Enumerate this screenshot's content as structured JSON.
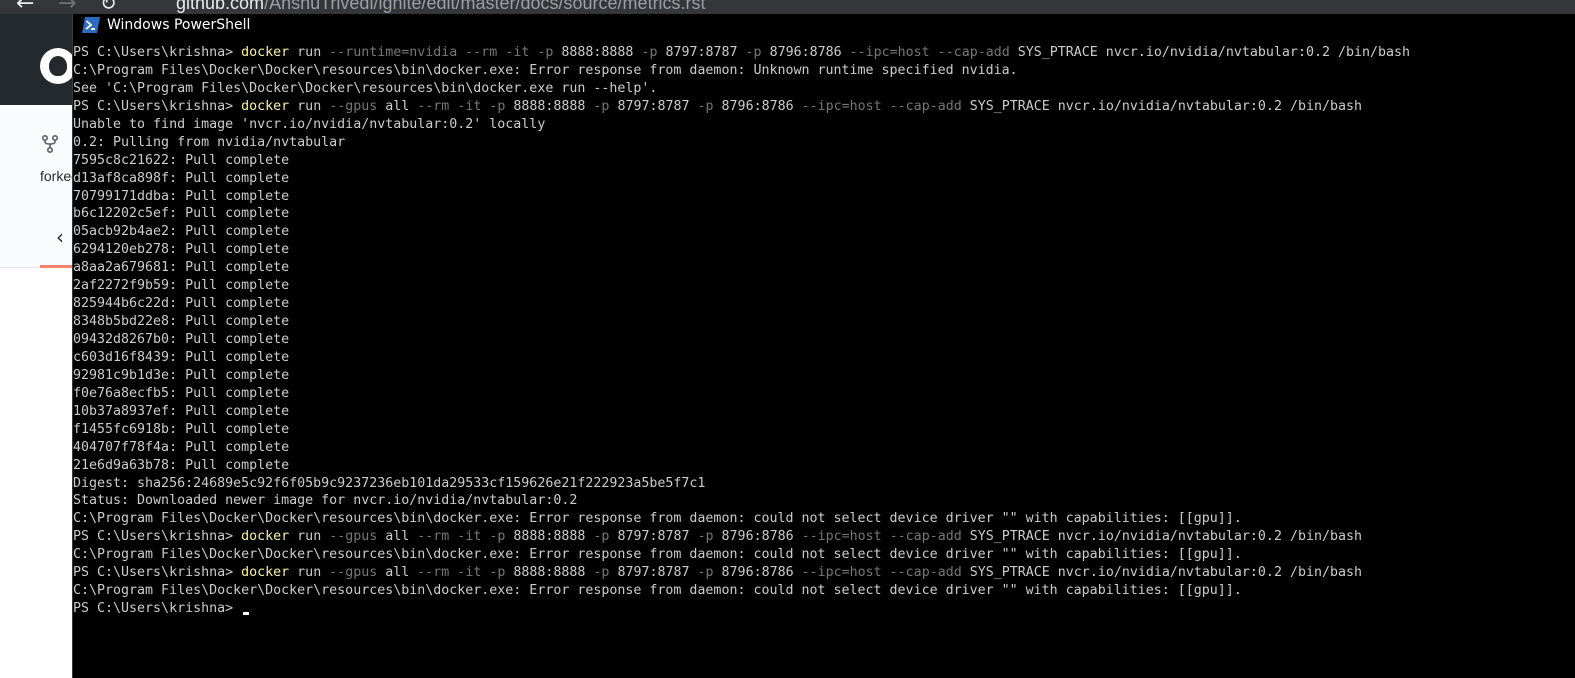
{
  "browser": {
    "back_glyph": "←",
    "forward_glyph": "→",
    "url_host": "github.com",
    "url_path": "/AnshuTrivedi/ignite/edit/master/docs/source/metrics.rst",
    "fork_label": "forked",
    "back_chevron": "‹"
  },
  "window": {
    "title": "Windows PowerShell",
    "icon": "powershell-icon"
  },
  "console": {
    "colors": {
      "background": "#000000",
      "text": "#cccccc",
      "command": "#f9f1a5",
      "parameter": "#767676"
    },
    "lines": [
      {
        "segments": [
          {
            "t": "PS C:\\Users\\krishna> ",
            "k": "arg"
          },
          {
            "t": "docker",
            "k": "cmd"
          },
          {
            "t": " run ",
            "k": "arg"
          },
          {
            "t": "--runtime=nvidia --rm -it -p ",
            "k": "param"
          },
          {
            "t": "8888:8888 ",
            "k": "arg"
          },
          {
            "t": "-p ",
            "k": "param"
          },
          {
            "t": "8797:8787 ",
            "k": "arg"
          },
          {
            "t": "-p ",
            "k": "param"
          },
          {
            "t": "8796:8786 ",
            "k": "arg"
          },
          {
            "t": "--ipc=host --cap-add ",
            "k": "param"
          },
          {
            "t": "SYS_PTRACE nvcr.io/nvidia/nvtabular:0.2 /bin/bash",
            "k": "arg"
          }
        ]
      },
      {
        "segments": [
          {
            "t": "C:\\Program Files\\Docker\\Docker\\resources\\bin\\docker.exe: Error response from daemon: Unknown runtime specified nvidia.",
            "k": "arg"
          }
        ]
      },
      {
        "segments": [
          {
            "t": "See 'C:\\Program Files\\Docker\\Docker\\resources\\bin\\docker.exe run --help'.",
            "k": "arg"
          }
        ]
      },
      {
        "segments": [
          {
            "t": "PS C:\\Users\\krishna> ",
            "k": "arg"
          },
          {
            "t": "docker",
            "k": "cmd"
          },
          {
            "t": " run ",
            "k": "arg"
          },
          {
            "t": "--gpus ",
            "k": "param"
          },
          {
            "t": "all ",
            "k": "arg"
          },
          {
            "t": "--rm -it -p ",
            "k": "param"
          },
          {
            "t": "8888:8888 ",
            "k": "arg"
          },
          {
            "t": "-p ",
            "k": "param"
          },
          {
            "t": "8797:8787 ",
            "k": "arg"
          },
          {
            "t": "-p ",
            "k": "param"
          },
          {
            "t": "8796:8786 ",
            "k": "arg"
          },
          {
            "t": "--ipc=host --cap-add ",
            "k": "param"
          },
          {
            "t": "SYS_PTRACE nvcr.io/nvidia/nvtabular:0.2 /bin/bash",
            "k": "arg"
          }
        ]
      },
      {
        "segments": [
          {
            "t": "Unable to find image 'nvcr.io/nvidia/nvtabular:0.2' locally",
            "k": "arg"
          }
        ]
      },
      {
        "segments": [
          {
            "t": "0.2: Pulling from nvidia/nvtabular",
            "k": "arg"
          }
        ]
      },
      {
        "segments": [
          {
            "t": "7595c8c21622: Pull complete",
            "k": "arg"
          }
        ]
      },
      {
        "segments": [
          {
            "t": "d13af8ca898f: Pull complete",
            "k": "arg"
          }
        ]
      },
      {
        "segments": [
          {
            "t": "70799171ddba: Pull complete",
            "k": "arg"
          }
        ]
      },
      {
        "segments": [
          {
            "t": "b6c12202c5ef: Pull complete",
            "k": "arg"
          }
        ]
      },
      {
        "segments": [
          {
            "t": "05acb92b4ae2: Pull complete",
            "k": "arg"
          }
        ]
      },
      {
        "segments": [
          {
            "t": "6294120eb278: Pull complete",
            "k": "arg"
          }
        ]
      },
      {
        "segments": [
          {
            "t": "a8aa2a679681: Pull complete",
            "k": "arg"
          }
        ]
      },
      {
        "segments": [
          {
            "t": "2af2272f9b59: Pull complete",
            "k": "arg"
          }
        ]
      },
      {
        "segments": [
          {
            "t": "825944b6c22d: Pull complete",
            "k": "arg"
          }
        ]
      },
      {
        "segments": [
          {
            "t": "8348b5bd22e8: Pull complete",
            "k": "arg"
          }
        ]
      },
      {
        "segments": [
          {
            "t": "09432d8267b0: Pull complete",
            "k": "arg"
          }
        ]
      },
      {
        "segments": [
          {
            "t": "c603d16f8439: Pull complete",
            "k": "arg"
          }
        ]
      },
      {
        "segments": [
          {
            "t": "92981c9b1d3e: Pull complete",
            "k": "arg"
          }
        ]
      },
      {
        "segments": [
          {
            "t": "f0e76a8ecfb5: Pull complete",
            "k": "arg"
          }
        ]
      },
      {
        "segments": [
          {
            "t": "10b37a8937ef: Pull complete",
            "k": "arg"
          }
        ]
      },
      {
        "segments": [
          {
            "t": "f1455fc6918b: Pull complete",
            "k": "arg"
          }
        ]
      },
      {
        "segments": [
          {
            "t": "404707f78f4a: Pull complete",
            "k": "arg"
          }
        ]
      },
      {
        "segments": [
          {
            "t": "21e6d9a63b78: Pull complete",
            "k": "arg"
          }
        ]
      },
      {
        "segments": [
          {
            "t": "Digest: sha256:24689e5c92f6f05b9c9237236eb101da29533cf159626e21f222923a5be5f7c1",
            "k": "arg"
          }
        ]
      },
      {
        "segments": [
          {
            "t": "Status: Downloaded newer image for nvcr.io/nvidia/nvtabular:0.2",
            "k": "arg"
          }
        ]
      },
      {
        "segments": [
          {
            "t": "C:\\Program Files\\Docker\\Docker\\resources\\bin\\docker.exe: Error response from daemon: could not select device driver \"\" with capabilities: [[gpu]].",
            "k": "arg"
          }
        ]
      },
      {
        "segments": [
          {
            "t": "PS C:\\Users\\krishna> ",
            "k": "arg"
          },
          {
            "t": "docker",
            "k": "cmd"
          },
          {
            "t": " run ",
            "k": "arg"
          },
          {
            "t": "--gpus ",
            "k": "param"
          },
          {
            "t": "all ",
            "k": "arg"
          },
          {
            "t": "--rm -it -p ",
            "k": "param"
          },
          {
            "t": "8888:8888 ",
            "k": "arg"
          },
          {
            "t": "-p ",
            "k": "param"
          },
          {
            "t": "8797:8787 ",
            "k": "arg"
          },
          {
            "t": "-p ",
            "k": "param"
          },
          {
            "t": "8796:8786 ",
            "k": "arg"
          },
          {
            "t": "--ipc=host --cap-add ",
            "k": "param"
          },
          {
            "t": "SYS_PTRACE nvcr.io/nvidia/nvtabular:0.2 /bin/bash",
            "k": "arg"
          }
        ]
      },
      {
        "segments": [
          {
            "t": "C:\\Program Files\\Docker\\Docker\\resources\\bin\\docker.exe: Error response from daemon: could not select device driver \"\" with capabilities: [[gpu]].",
            "k": "arg"
          }
        ]
      },
      {
        "segments": [
          {
            "t": "PS C:\\Users\\krishna> ",
            "k": "arg"
          },
          {
            "t": "docker",
            "k": "cmd"
          },
          {
            "t": " run ",
            "k": "arg"
          },
          {
            "t": "--gpus ",
            "k": "param"
          },
          {
            "t": "all ",
            "k": "arg"
          },
          {
            "t": "--rm -it -p ",
            "k": "param"
          },
          {
            "t": "8888:8888 ",
            "k": "arg"
          },
          {
            "t": "-p ",
            "k": "param"
          },
          {
            "t": "8797:8787 ",
            "k": "arg"
          },
          {
            "t": "-p ",
            "k": "param"
          },
          {
            "t": "8796:8786 ",
            "k": "arg"
          },
          {
            "t": "--ipc=host --cap-add ",
            "k": "param"
          },
          {
            "t": "SYS_PTRACE nvcr.io/nvidia/nvtabular:0.2 /bin/bash",
            "k": "arg"
          }
        ]
      },
      {
        "segments": [
          {
            "t": "C:\\Program Files\\Docker\\Docker\\resources\\bin\\docker.exe: Error response from daemon: could not select device driver \"\" with capabilities: [[gpu]].",
            "k": "arg"
          }
        ]
      },
      {
        "segments": [
          {
            "t": "PS C:\\Users\\krishna> ",
            "k": "arg"
          }
        ],
        "cursor": true
      }
    ]
  }
}
